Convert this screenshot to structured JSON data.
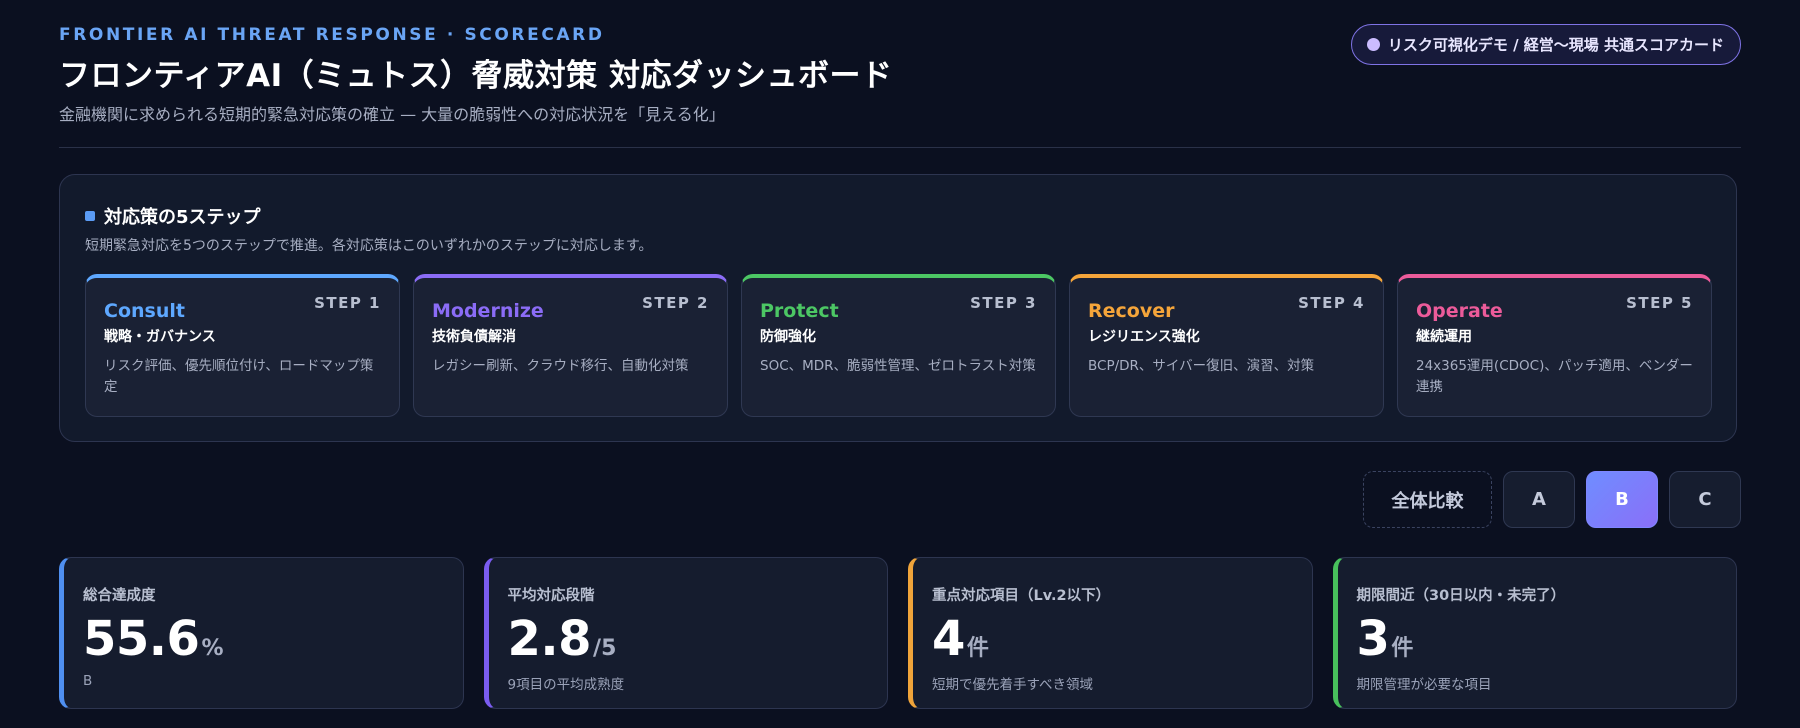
{
  "header": {
    "eyebrow": "FRONTIER AI THREAT RESPONSE · SCORECARD",
    "title": "フロンティアAI（ミュトス）脅威対策 対応ダッシュボード",
    "subtitle": "金融機関に求められる短期的緊急対応策の確立 — 大量の脆弱性への対応状況を「見える化」",
    "badge": "リスク可視化デモ / 経営〜現場 共通スコアカード"
  },
  "steps": {
    "heading": "対応策の5ステップ",
    "description": "短期緊急対応を5つのステップで推進。各対応策はこのいずれかのステップに対応します。",
    "items": [
      {
        "name": "Consult",
        "step": "STEP 1",
        "sub": "戦略・ガバナンス",
        "detail": "リスク評価、優先順位付け、ロードマップ策定",
        "color": "#5ea8ff"
      },
      {
        "name": "Modernize",
        "step": "STEP 2",
        "sub": "技術負債解消",
        "detail": "レガシー刷新、クラウド移行、自動化対策",
        "color": "#8b6cf6"
      },
      {
        "name": "Protect",
        "step": "STEP 3",
        "sub": "防御強化",
        "detail": "SOC、MDR、脆弱性管理、ゼロトラスト対策",
        "color": "#4cc764"
      },
      {
        "name": "Recover",
        "step": "STEP 4",
        "sub": "レジリエンス強化",
        "detail": "BCP/DR、サイバー復旧、演習、対策",
        "color": "#f5a53a"
      },
      {
        "name": "Operate",
        "step": "STEP 5",
        "sub": "継続運用",
        "detail": "24x365運用(CDOC)、パッチ適用、ベンダー連携",
        "color": "#ec5b9a"
      }
    ]
  },
  "filters": {
    "all": "全体比較",
    "a": "A",
    "b": "B",
    "c": "C",
    "active": "B"
  },
  "kpis": [
    {
      "label": "総合達成度",
      "value": "55.6",
      "unit": "%",
      "note": "B",
      "color": "#4f8ff0"
    },
    {
      "label": "平均対応段階",
      "value": "2.8",
      "unit": "/5",
      "note": "9項目の平均成熟度",
      "color": "#7a5cf0"
    },
    {
      "label": "重点対応項目（Lv.2以下）",
      "value": "4",
      "unit": "件",
      "note": "短期で優先着手すべき領域",
      "color": "#f0a43a"
    },
    {
      "label": "期限間近（30日以内・未完了）",
      "value": "3",
      "unit": "件",
      "note": "期限管理が必要な項目",
      "color": "#48c05c"
    }
  ]
}
